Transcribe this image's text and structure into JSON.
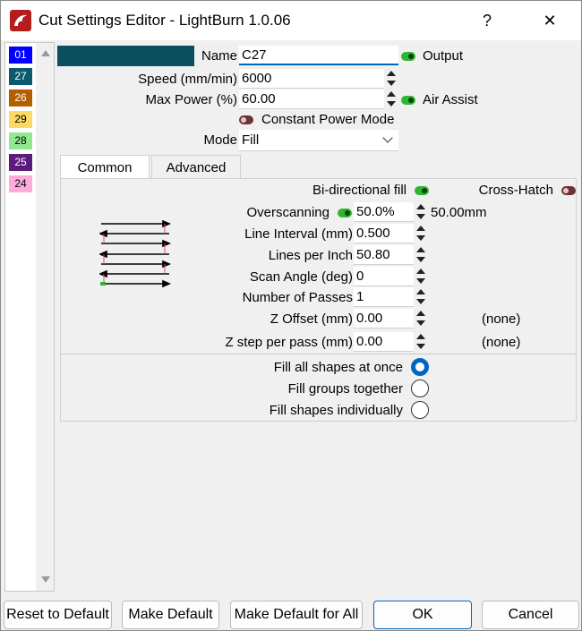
{
  "window": {
    "title": "Cut Settings Editor - LightBurn 1.0.06",
    "help_glyph": "?",
    "close_glyph": "✕"
  },
  "layers": [
    {
      "id": "01",
      "color": "#0000ff",
      "text_color": "#ffffff"
    },
    {
      "id": "27",
      "color": "#0b5a6e",
      "text_color": "#ffffff"
    },
    {
      "id": "26",
      "color": "#b35f00",
      "text_color": "#ffffff"
    },
    {
      "id": "29",
      "color": "#ffd966",
      "text_color": "#000000"
    },
    {
      "id": "28",
      "color": "#90e890",
      "text_color": "#000000"
    },
    {
      "id": "25",
      "color": "#5c1a7a",
      "text_color": "#ffffff"
    },
    {
      "id": "24",
      "color": "#ffaadd",
      "text_color": "#000000"
    }
  ],
  "header": {
    "swatch_color": "#0b4f5e",
    "name_label": "Name",
    "name_value": "C27",
    "output_label": "Output",
    "output_on": true,
    "speed_label": "Speed (mm/min)",
    "speed_value": "6000",
    "power_label": "Max Power (%)",
    "power_value": "60.00",
    "air_assist_label": "Air Assist",
    "air_assist_on": true,
    "constant_power_label": "Constant Power Mode",
    "constant_power_on": false,
    "mode_label": "Mode",
    "mode_value": "Fill"
  },
  "tabs": [
    {
      "label": "Common",
      "active": true
    },
    {
      "label": "Advanced",
      "active": false
    }
  ],
  "common": {
    "bidirectional_label": "Bi-directional fill",
    "bidirectional_on": true,
    "crosshatch_label": "Cross-Hatch",
    "crosshatch_on": false,
    "overscanning_label": "Overscanning",
    "overscanning_on": true,
    "overscanning_value": "50.0%",
    "overscanning_mm": "50.00mm",
    "line_interval_label": "Line Interval (mm)",
    "line_interval_value": "0.500",
    "lpi_label": "Lines per Inch",
    "lpi_value": "50.80",
    "scan_angle_label": "Scan Angle (deg)",
    "scan_angle_value": "0",
    "passes_label": "Number of Passes",
    "passes_value": "1",
    "z_offset_label": "Z Offset (mm)",
    "z_offset_value": "0.00",
    "z_offset_note": "(none)",
    "z_step_label": "Z step per pass (mm)",
    "z_step_value": "0.00",
    "z_step_note": "(none)",
    "fill_options": [
      {
        "label": "Fill all shapes at once",
        "checked": true
      },
      {
        "label": "Fill groups together",
        "checked": false
      },
      {
        "label": "Fill shapes individually",
        "checked": false
      }
    ]
  },
  "footer": {
    "reset_label": "Reset to Default",
    "make_default_label": "Make Default",
    "make_default_all_label": "Make Default for All",
    "ok_label": "OK",
    "cancel_label": "Cancel"
  }
}
